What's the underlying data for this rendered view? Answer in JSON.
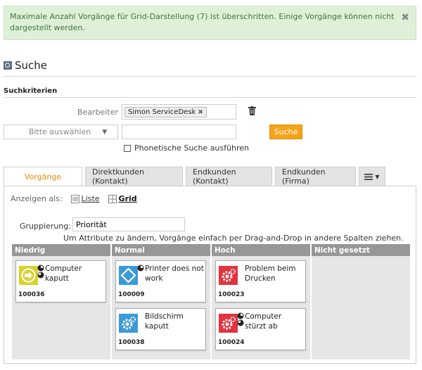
{
  "alert": {
    "message": "Maximale Anzahl Vorgänge für Grid-Darstellung (7) ist überschritten. Einige Vorgänge können nicht dargestellt werden.",
    "close_icon": "close-icon"
  },
  "search": {
    "title": "Suche",
    "criteria_heading": "Suchkriterien",
    "bearbeiter_label": "Bearbeiter",
    "bearbeiter_tag": "Simon ServiceDesk",
    "select_placeholder": "Bitte auswählen",
    "text_value": "",
    "search_button": "Suche",
    "phonetic_label": "Phonetische Suche ausführen",
    "phonetic_checked": false
  },
  "tabs": [
    {
      "label": "Vorgänge",
      "active": true
    },
    {
      "label": "Direktkunden (Kontakt)",
      "active": false
    },
    {
      "label": "Endkunden (Kontakt)",
      "active": false
    },
    {
      "label": "Endkunden (Firma)",
      "active": false
    }
  ],
  "view": {
    "label": "Anzeigen als:",
    "list_label": "Liste",
    "grid_label": "Grid",
    "active": "Grid"
  },
  "grouping": {
    "label": "Gruppierung:",
    "value": "Priorität",
    "hint": "Um Attribute zu ändern, Vorgänge einfach per Drag-and-Drop in andere Spalten ziehen."
  },
  "columns": [
    {
      "title": "Niedrig"
    },
    {
      "title": "Normal"
    },
    {
      "title": "Hoch"
    },
    {
      "title": "Nicht gesetzt"
    }
  ],
  "cards": [
    {
      "title": "Computer kaputt",
      "id": "100036",
      "icon": "arrow-circle-icon",
      "color": "#d9d22a"
    },
    {
      "title": "Printer does not work",
      "id": "100009",
      "icon": "diamond-icon",
      "color": "#3a9ad9"
    },
    {
      "title": "Bildschirm kaputt",
      "id": "100038",
      "icon": "gear-icon",
      "color": "#3a9ad9"
    },
    {
      "title": "Problem beim Drucken",
      "id": "100023",
      "icon": "gear-icon",
      "color": "#e0343f"
    },
    {
      "title": "Computer stürzt ab",
      "id": "100024",
      "icon": "gear-icon",
      "color": "#e0343f"
    }
  ],
  "colors": {
    "alert_bg": "#dff0d8",
    "alert_text": "#3c763d",
    "accent": "#f5a31a",
    "active_tab": "#ee8a00",
    "column_header": "#979797"
  }
}
